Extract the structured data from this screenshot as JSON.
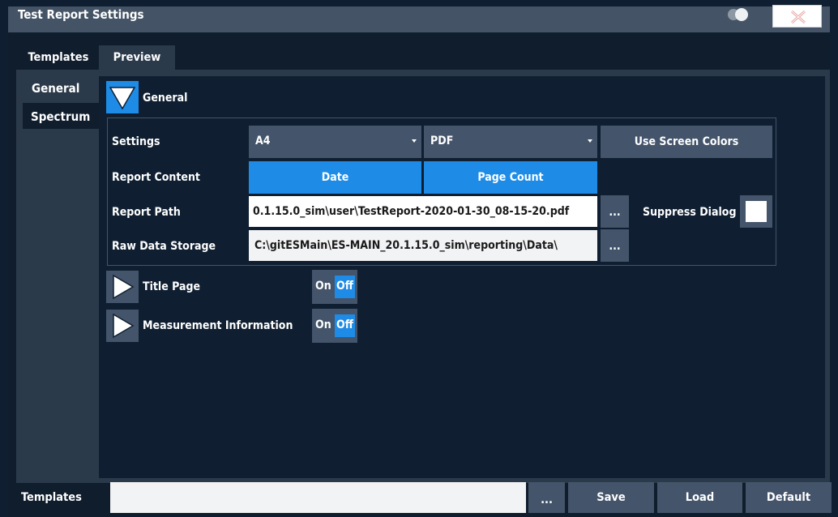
{
  "window": {
    "title": "Test Report Settings"
  },
  "tabs": [
    "Templates",
    "Preview"
  ],
  "side_tabs": [
    "General",
    "Spectrum"
  ],
  "general": {
    "header": "General",
    "settings": {
      "label": "Settings",
      "page_size": "A4",
      "format": "PDF",
      "screen_colors_button": "Use Screen Colors"
    },
    "report_content": {
      "label": "Report Content",
      "items": [
        "Date",
        "Page Count"
      ]
    },
    "report_path": {
      "label": "Report Path",
      "value": "0.1.15.0_sim\\user\\TestReport-2020-01-30_08-15-20.pdf",
      "browse": "...",
      "suppress_label": "Suppress Dialog",
      "suppress_checked": false
    },
    "raw_data": {
      "label": "Raw Data Storage",
      "value": "C:\\gitESMain\\ES-MAIN_20.1.15.0_sim\\reporting\\Data\\",
      "browse": "..."
    }
  },
  "sections": [
    {
      "label": "Title Page",
      "on": "On",
      "off": "Off",
      "state": "Off"
    },
    {
      "label": "Measurement Information",
      "on": "On",
      "off": "Off",
      "state": "Off"
    }
  ],
  "bottom": {
    "label": "Templates",
    "input_value": "",
    "browse": "...",
    "save": "Save",
    "load": "Load",
    "default": "Default"
  },
  "colors": {
    "accent": "#1e8ce6",
    "control": "#44546a",
    "panel": "#0f1f31",
    "titlebar": "#445466"
  },
  "icons": [
    "toggle-icon",
    "close-icon",
    "triangle-down-icon",
    "triangle-right-icon"
  ]
}
